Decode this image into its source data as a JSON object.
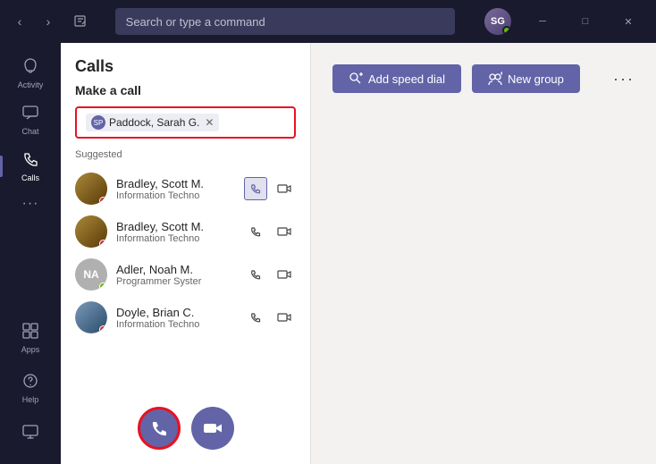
{
  "titlebar": {
    "back_label": "‹",
    "forward_label": "›",
    "compose_icon": "⊡",
    "search_placeholder": "Search or type a command",
    "minimize_label": "─",
    "maximize_label": "□",
    "close_label": "✕",
    "user_initials": "SG"
  },
  "sidebar": {
    "items": [
      {
        "id": "activity",
        "label": "Activity",
        "icon": "🔔"
      },
      {
        "id": "chat",
        "label": "Chat",
        "icon": "💬"
      },
      {
        "id": "calls",
        "label": "Calls",
        "icon": "📞",
        "active": true
      },
      {
        "id": "more",
        "label": "...",
        "icon": "···"
      }
    ],
    "bottom_items": [
      {
        "id": "apps",
        "label": "Apps",
        "icon": "⊞"
      },
      {
        "id": "help",
        "label": "Help",
        "icon": "?"
      }
    ],
    "device_icon": "🖥"
  },
  "calls_panel": {
    "header": "Calls",
    "make_call_title": "Make a call",
    "input_tag": {
      "initials": "SP",
      "name": "Paddock, Sarah G.",
      "close": "✕"
    },
    "suggested_label": "Suggested",
    "contacts": [
      {
        "id": "scott1",
        "name": "Bradley, Scott M.",
        "role": "Information Techno",
        "avatar_type": "photo",
        "avatar_bg": "#8B6914",
        "status": "busy",
        "phone_highlighted": true
      },
      {
        "id": "scott2",
        "name": "Bradley, Scott M.",
        "role": "Information Techno",
        "avatar_type": "photo",
        "avatar_bg": "#8B6914",
        "status": "busy",
        "phone_highlighted": false
      },
      {
        "id": "noah",
        "name": "Adler, Noah M.",
        "role": "Programmer Syster",
        "avatar_type": "initials",
        "initials": "NA",
        "avatar_bg": "#b0b0b0",
        "status": "available",
        "phone_highlighted": false
      },
      {
        "id": "doyle",
        "name": "Doyle, Brian C.",
        "role": "Information Techno",
        "avatar_type": "photo",
        "avatar_bg": "#5a7a9a",
        "status": "busy",
        "phone_highlighted": false
      }
    ],
    "dial_phone_icon": "📞",
    "dial_video_icon": "📷"
  },
  "main_content": {
    "add_speed_dial_label": "Add speed dial",
    "new_group_label": "New group",
    "more_options": "···"
  }
}
